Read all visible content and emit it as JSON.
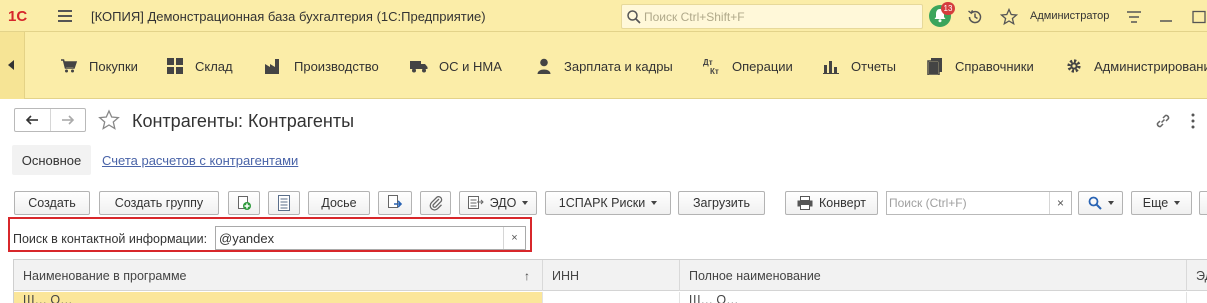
{
  "app": {
    "window_title": "[КОПИЯ] Демонстрационная база бухгалтерия  (1С:Предприятие)",
    "logo_text": "1С",
    "global_search_placeholder": "Поиск Ctrl+Shift+F",
    "notifications_count": "13",
    "user_name": "Администратор",
    "colors": {
      "panel": "#fbeda8",
      "accent_red": "#d8272b",
      "link": "#4a64a8",
      "row_highlight": "#fbe69a"
    }
  },
  "sections": [
    {
      "label": "Покупки",
      "icon": "cart-icon"
    },
    {
      "label": "Склад",
      "icon": "warehouse-grid-icon"
    },
    {
      "label": "Производство",
      "icon": "factory-icon"
    },
    {
      "label": "ОС и НМА",
      "icon": "truck-icon"
    },
    {
      "label": "Зарплата и кадры",
      "icon": "person-icon"
    },
    {
      "label": "Операции",
      "icon": "dt-kt-icon"
    },
    {
      "label": "Отчеты",
      "icon": "bar-chart-icon"
    },
    {
      "label": "Справочники",
      "icon": "books-icon"
    },
    {
      "label": "Администрирование",
      "icon": "gear-icon"
    }
  ],
  "form": {
    "title": "Контрагенты: Контрагенты",
    "tabs": [
      {
        "label": "Основное",
        "active": true
      },
      {
        "label": "Счета расчетов с контрагентами",
        "active": false
      }
    ]
  },
  "toolbar": {
    "create": "Создать",
    "create_group": "Создать группу",
    "dossier": "Досье",
    "edo": "ЭДО",
    "spark": "1СПАРК Риски",
    "load": "Загрузить",
    "envelope": "Конверт",
    "search_placeholder": "Поиск (Ctrl+F)",
    "search_clear": "×",
    "more": "Еще"
  },
  "contact_search": {
    "label": "Поиск в контактной информации:",
    "value": "@yandex",
    "clear": "×"
  },
  "table": {
    "columns": [
      {
        "label": "Наименование в программе",
        "sort": "↑"
      },
      {
        "label": "ИНН"
      },
      {
        "label": "Полное наименование"
      },
      {
        "label": "ЭД"
      }
    ],
    "rows": [
      [
        "Ш… О…",
        "",
        "Ш… О…",
        ""
      ]
    ]
  }
}
